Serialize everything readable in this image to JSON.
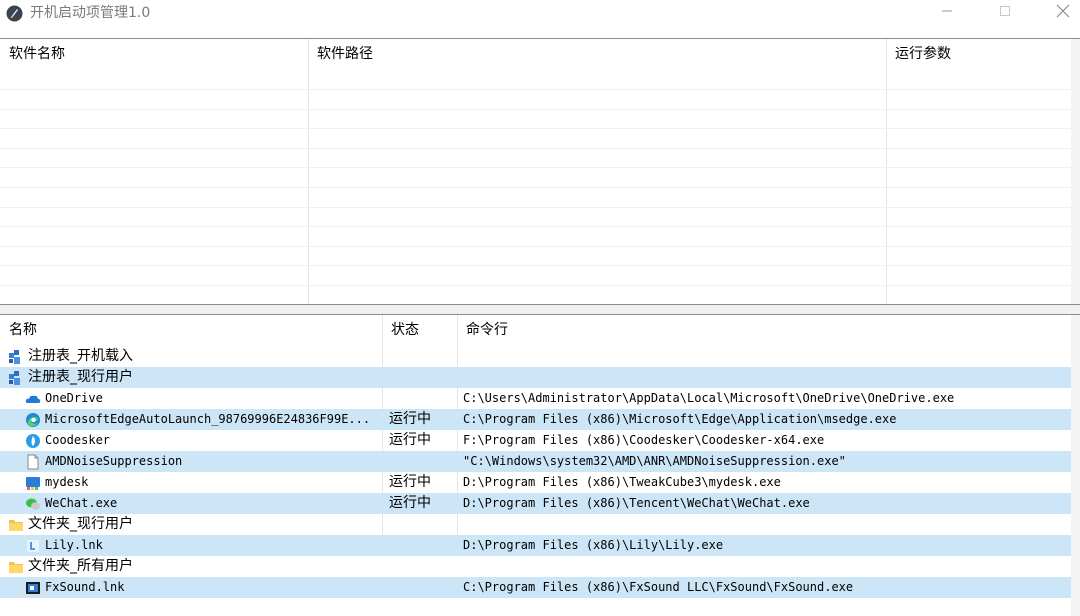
{
  "window": {
    "title": "开机启动项管理1.0",
    "controls": [
      "minimize",
      "maximize",
      "close"
    ]
  },
  "top_table": {
    "headers": [
      "软件名称",
      "软件路径",
      "运行参数"
    ],
    "rows": []
  },
  "bottom_table": {
    "headers": [
      "名称",
      "状态",
      "命令行"
    ],
    "rows": [
      {
        "level": 0,
        "icon": "registry-icon",
        "name": "注册表_开机载入",
        "status": "",
        "command": ""
      },
      {
        "level": 0,
        "icon": "registry-icon",
        "name": "注册表_现行用户",
        "status": "",
        "command": ""
      },
      {
        "level": 1,
        "icon": "onedrive-icon",
        "name": "OneDrive",
        "status": "",
        "command": "C:\\Users\\Administrator\\AppData\\Local\\Microsoft\\OneDrive\\OneDrive.exe"
      },
      {
        "level": 1,
        "icon": "edge-icon",
        "name": "MicrosoftEdgeAutoLaunch_98769996E24836F99E...",
        "status": "运行中",
        "command": "C:\\Program Files (x86)\\Microsoft\\Edge\\Application\\msedge.exe"
      },
      {
        "level": 1,
        "icon": "coodesker-icon",
        "name": "Coodesker",
        "status": "运行中",
        "command": "F:\\Program Files (x86)\\Coodesker\\Coodesker-x64.exe"
      },
      {
        "level": 1,
        "icon": "file-icon",
        "name": "AMDNoiseSuppression",
        "status": "",
        "command": "\"C:\\Windows\\system32\\AMD\\ANR\\AMDNoiseSuppression.exe\""
      },
      {
        "level": 1,
        "icon": "mydesk-icon",
        "name": "mydesk",
        "status": "运行中",
        "command": "D:\\Program Files (x86)\\TweakCube3\\mydesk.exe"
      },
      {
        "level": 1,
        "icon": "wechat-icon",
        "name": "WeChat.exe",
        "status": "运行中",
        "command": "D:\\Program Files (x86)\\Tencent\\WeChat\\WeChat.exe"
      },
      {
        "level": 0,
        "icon": "folder-icon",
        "name": "文件夹_现行用户",
        "status": "",
        "command": ""
      },
      {
        "level": 1,
        "icon": "lily-icon",
        "name": "Lily.lnk",
        "status": "",
        "command": "D:\\Program Files (x86)\\Lily\\Lily.exe"
      },
      {
        "level": 0,
        "icon": "folder-icon",
        "name": "文件夹_所有用户",
        "status": "",
        "command": ""
      },
      {
        "level": 1,
        "icon": "fxsound-icon",
        "name": "FxSound.lnk",
        "status": "",
        "command": "C:\\Program Files (x86)\\FxSound LLC\\FxSound\\FxSound.exe"
      }
    ]
  },
  "colors": {
    "row_alt": "#cde6f7",
    "panel_border": "#8c8c8c"
  }
}
